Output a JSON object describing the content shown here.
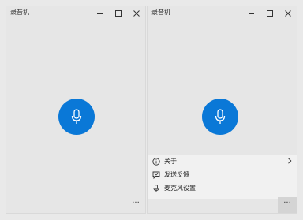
{
  "windows": [
    {
      "title": "录音机",
      "more_label": "..."
    },
    {
      "title": "录音机",
      "more_label": "...",
      "menu": [
        {
          "label": "关于",
          "icon": "info-icon",
          "has_chevron": true
        },
        {
          "label": "发送反馈",
          "icon": "feedback-icon",
          "has_chevron": false
        },
        {
          "label": "麦克风设置",
          "icon": "microphone-icon",
          "has_chevron": false
        }
      ]
    }
  ],
  "colors": {
    "accent": "#0a78d7",
    "window_bg": "#e6e6e6",
    "menu_bg": "#f1f1f1"
  }
}
